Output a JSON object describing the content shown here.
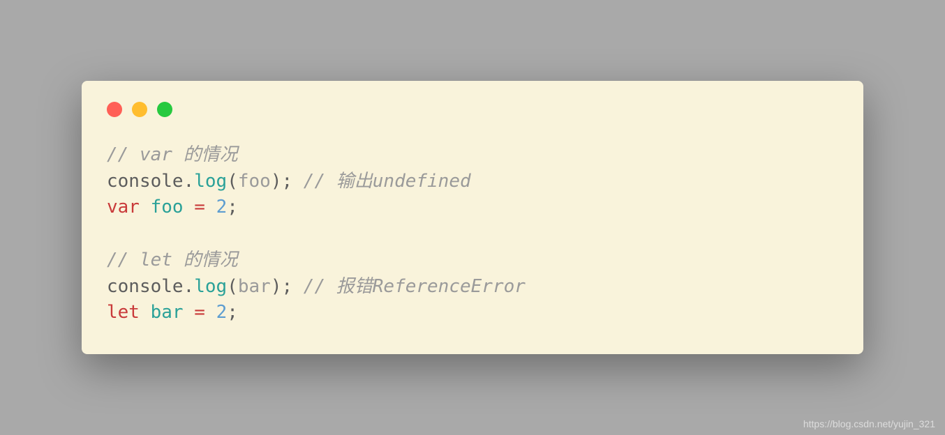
{
  "code": {
    "line1": {
      "comment": "// var 的情况"
    },
    "line2": {
      "obj": "console",
      "dot": ".",
      "method": "log",
      "openParen": "(",
      "param": "foo",
      "closeParen": ")",
      "semi": ";",
      "space": " ",
      "comment": "// 输出undefined"
    },
    "line3": {
      "keyword": "var",
      "space1": " ",
      "varname": "foo",
      "space2": " ",
      "op": "=",
      "space3": " ",
      "num": "2",
      "semi": ";"
    },
    "line4": {
      "blank": ""
    },
    "line5": {
      "comment": "// let 的情况"
    },
    "line6": {
      "obj": "console",
      "dot": ".",
      "method": "log",
      "openParen": "(",
      "param": "bar",
      "closeParen": ")",
      "semi": ";",
      "space": " ",
      "comment": "// 报错ReferenceError"
    },
    "line7": {
      "keyword": "let",
      "space1": " ",
      "varname": "bar",
      "space2": " ",
      "op": "=",
      "space3": " ",
      "num": "2",
      "semi": ";"
    }
  },
  "watermark": "https://blog.csdn.net/yujin_321"
}
